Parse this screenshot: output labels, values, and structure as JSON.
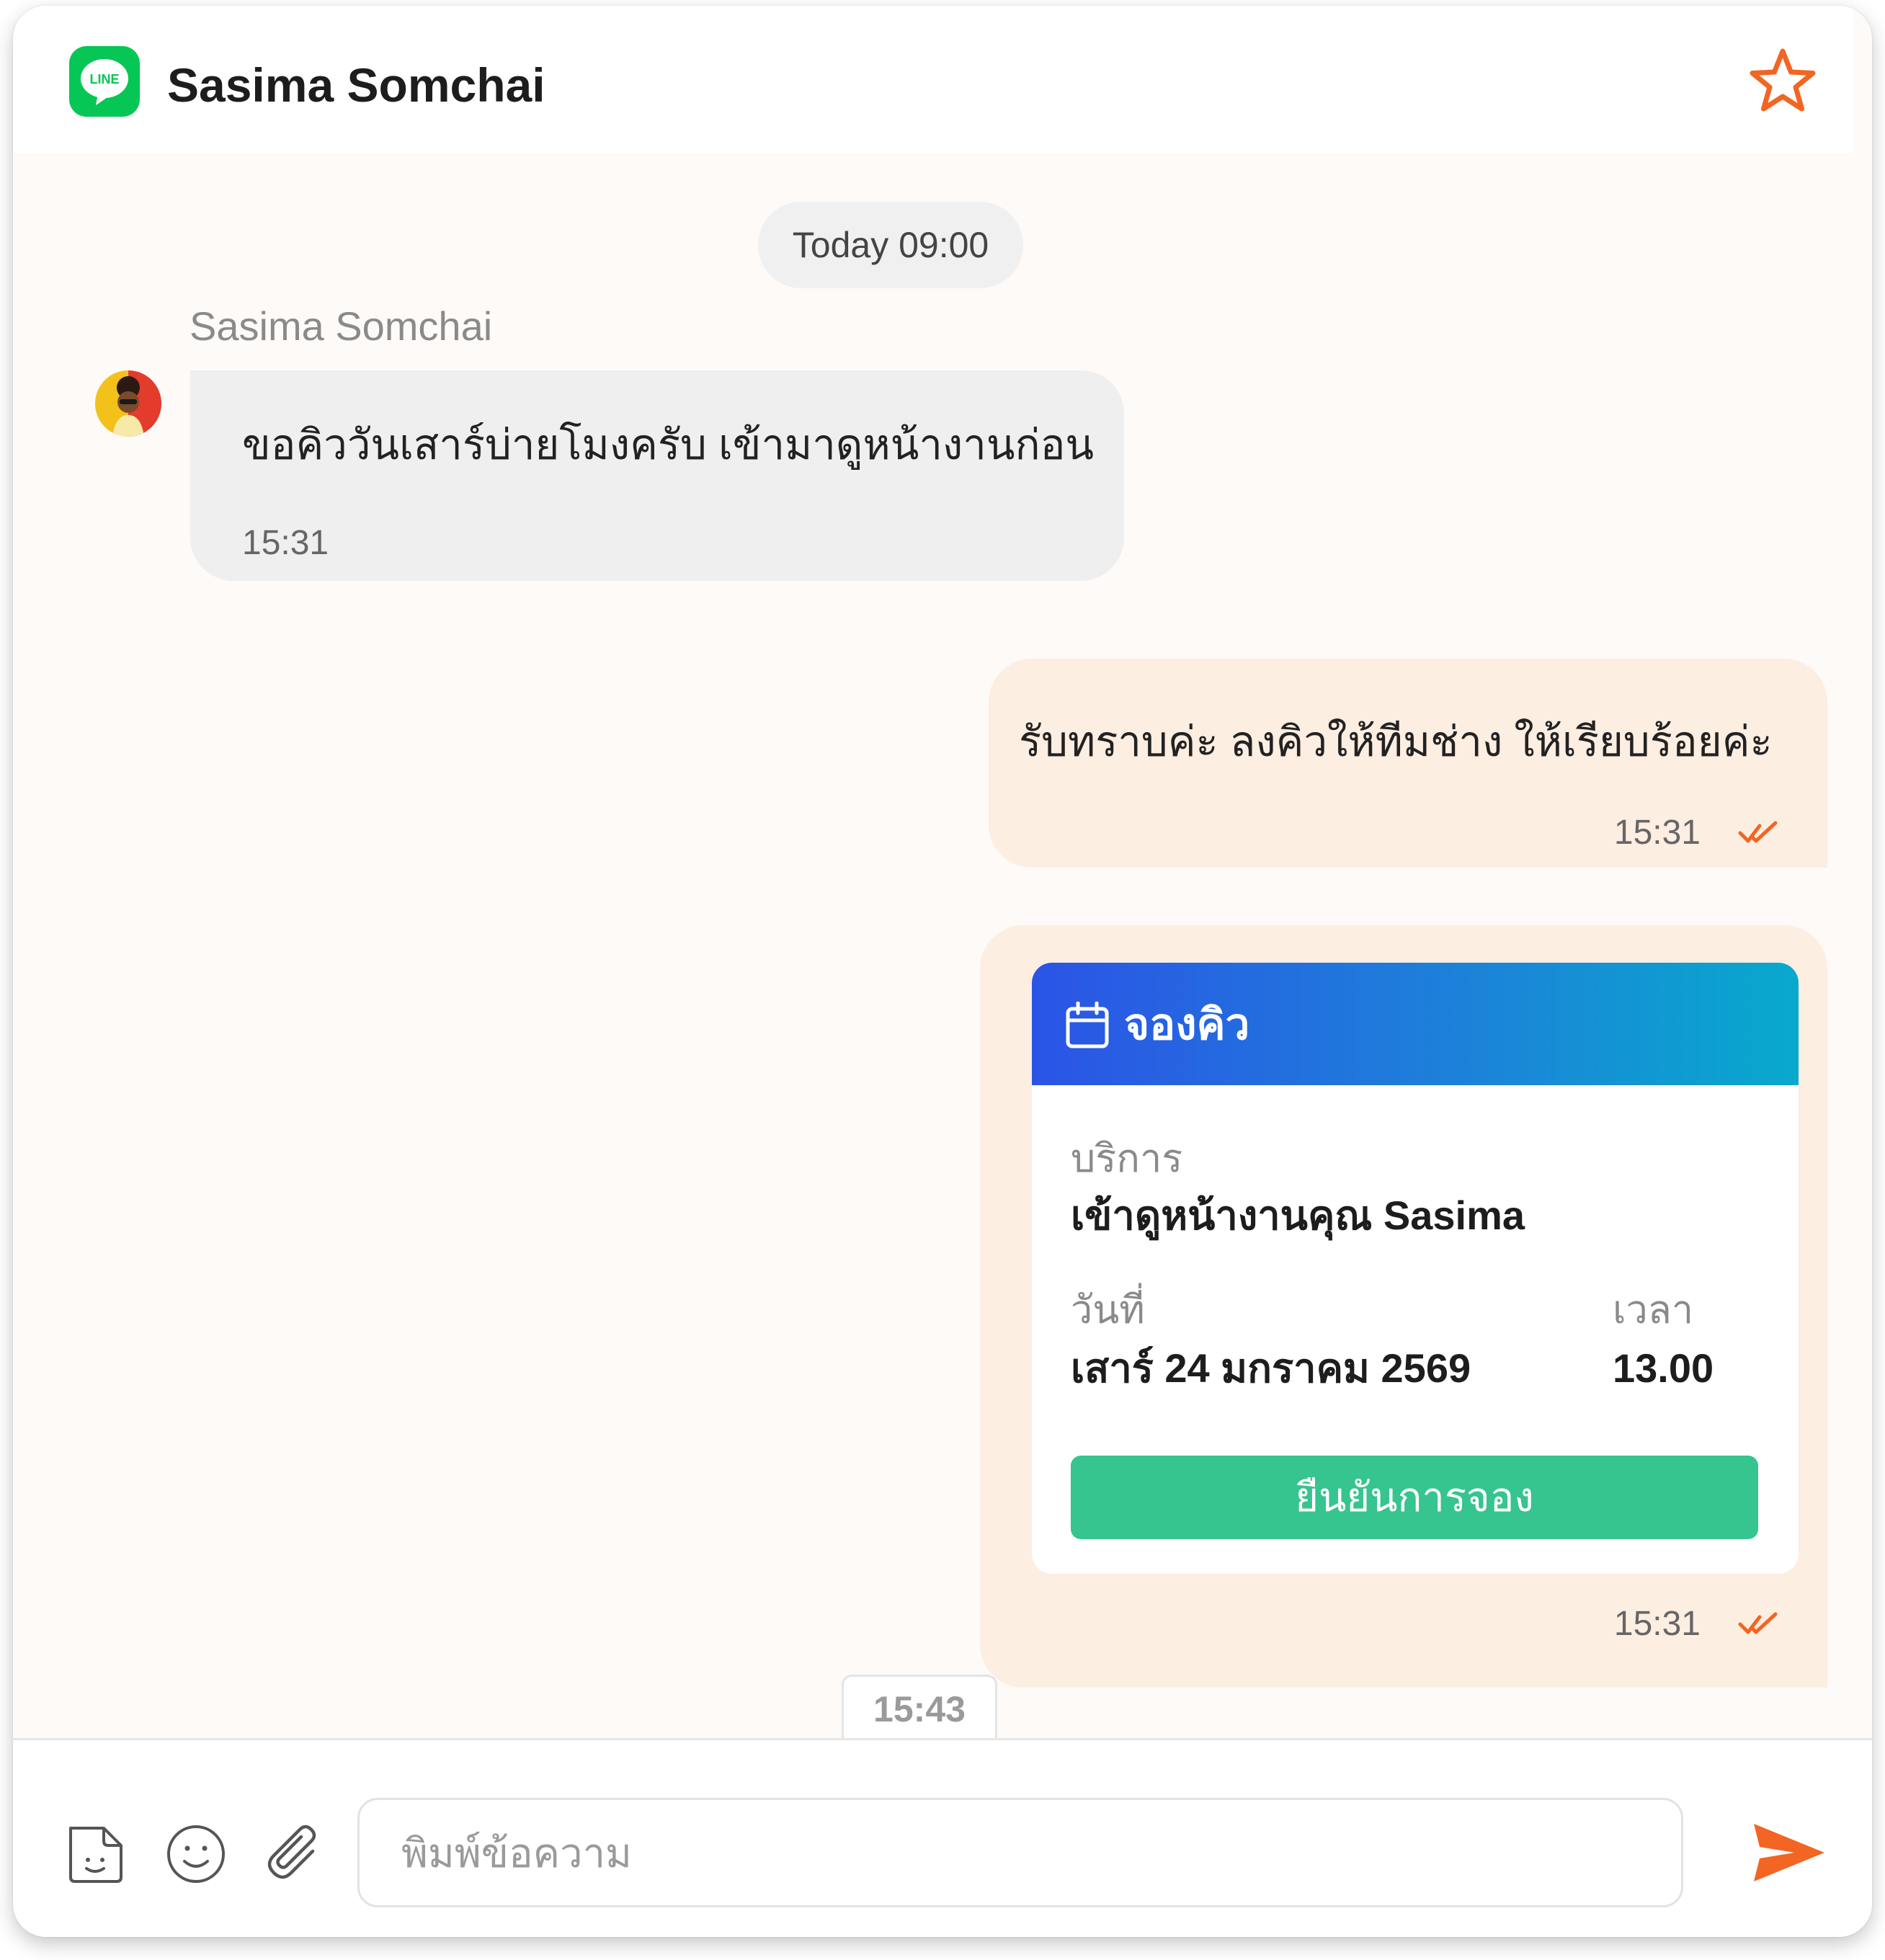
{
  "header": {
    "title": "Sasima Somchai",
    "logo_text": "LINE",
    "accent": "#f26522"
  },
  "chat": {
    "date_chip": "Today 09:00",
    "incoming": {
      "sender": "Sasima Somchai",
      "text": "ขอคิววันเสาร์บ่ายโมงครับ เข้ามาดูหน้างานก่อน",
      "time": "15:31"
    },
    "outgoing_text": {
      "text": "รับทราบค่ะ ลงคิวให้ทีมช่าง ให้เรียบร้อยค่ะ",
      "time": "15:31",
      "status": "read"
    },
    "booking_card": {
      "title": "จองคิว",
      "service_label": "บริการ",
      "service_value": "เข้าดูหน้างานคุณ Sasima",
      "date_label": "วันที่",
      "date_value": "เสาร์ 24 มกราคม 2569",
      "time_label": "เวลา",
      "time_value": "13.00",
      "confirm_label": "ยืนยันการจอง",
      "sent_time": "15:31",
      "status": "read"
    },
    "time_marker": "15:43"
  },
  "composer": {
    "placeholder": "พิมพ์ข้อความ",
    "value": "",
    "icons": [
      "sticker-icon",
      "emoji-icon",
      "attachment-icon",
      "send-icon"
    ]
  },
  "colors": {
    "incoming_bubble": "#efefef",
    "outgoing_bubble": "#fdeee2",
    "card_gradient_start": "#2b54e6",
    "card_gradient_end": "#08a9cd",
    "confirm_button": "#36c48f",
    "line_green": "#06c755"
  }
}
